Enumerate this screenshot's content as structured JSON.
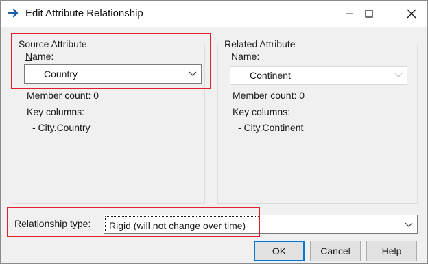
{
  "window": {
    "title": "Edit Attribute Relationship"
  },
  "source": {
    "legend": "Source Attribute",
    "name_label_u": "N",
    "name_label_rest": "ame:",
    "selected": "Country",
    "member_count": "Member count: 0",
    "key_columns_label": "Key columns:",
    "key_column": "- City.Country"
  },
  "related": {
    "legend": "Related Attribute",
    "name_label": "Name:",
    "selected": "Continent",
    "member_count": "Member count: 0",
    "key_columns_label": "Key columns:",
    "key_column": "- City.Continent"
  },
  "relationship": {
    "label_u": "R",
    "label_rest": "elationship type:",
    "selected": "Rigid (will not change over time)"
  },
  "buttons": {
    "ok": "OK",
    "cancel": "Cancel",
    "help": "Help"
  },
  "colors": {
    "highlight": "#e0202a",
    "title_icon": "#1f5fa8",
    "default_button_border": "#0078d7"
  },
  "icons": {
    "title": "arrow-right-icon",
    "minimize": "minimize-icon",
    "maximize": "maximize-icon",
    "close": "close-icon",
    "dropdown": "chevron-down-icon"
  }
}
